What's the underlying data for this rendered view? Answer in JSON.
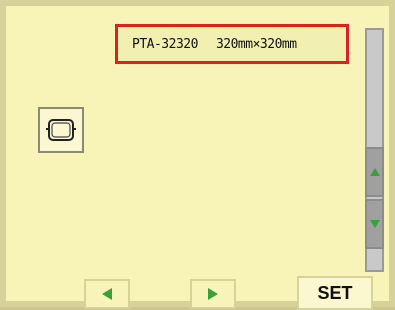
{
  "hoop": {
    "model": "PTA-32320",
    "size": "320mm×320mm"
  },
  "icons": {
    "hoop": "embroidery-hoop-icon",
    "scroll_up": "triangle-up-icon",
    "scroll_down": "triangle-down-icon",
    "prev": "arrow-left-icon",
    "next": "arrow-right-icon"
  },
  "buttons": {
    "set_label": "SET"
  },
  "colors": {
    "screen_bg": "#f8f3b7",
    "accent_highlight": "#d8231e",
    "arrow_green": "#3aa13a"
  }
}
